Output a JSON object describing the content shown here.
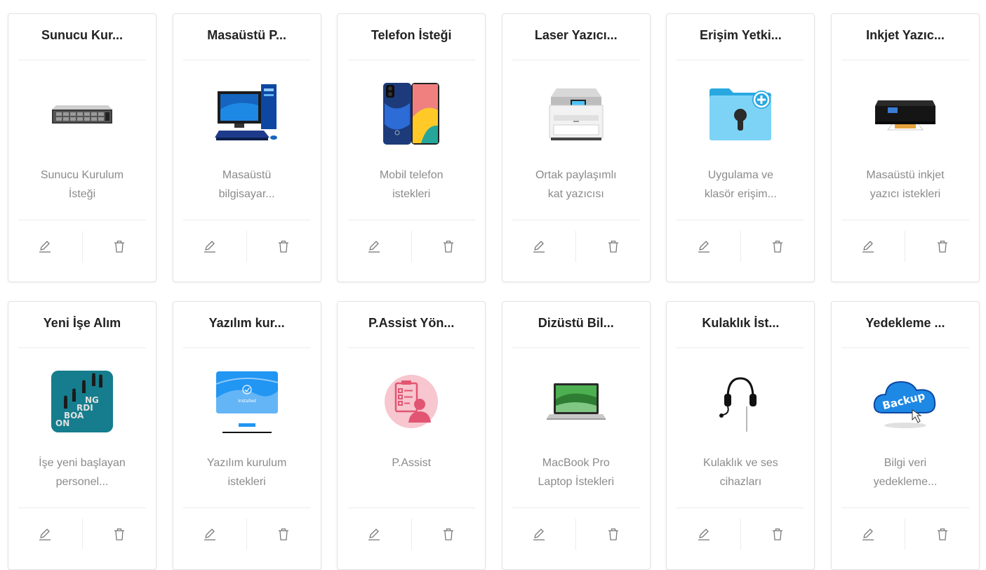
{
  "cards": [
    {
      "title": "Sunucu Kur...",
      "description": "Sunucu Kurulum İsteği",
      "image": "server-rack-image"
    },
    {
      "title": "Masaüstü P...",
      "description": "Masaüstü bilgisayar...",
      "image": "desktop-computer-image"
    },
    {
      "title": "Telefon İsteği",
      "description": "Mobil telefon istekleri",
      "image": "mobile-phone-image"
    },
    {
      "title": "Laser Yazıcı...",
      "description": "Ortak paylaşımlı kat yazıcısı",
      "image": "laser-printer-image"
    },
    {
      "title": "Erişim Yetki...",
      "description": "Uygulama ve klasör erişim...",
      "image": "folder-access-image"
    },
    {
      "title": "Inkjet Yazıc...",
      "description": "Masaüstü inkjet yazıcı istekleri",
      "image": "inkjet-printer-image"
    },
    {
      "title": "Yeni İşe Alım",
      "description": "İşe yeni başlayan personel...",
      "image": "onboarding-image",
      "image_text": [
        "NG",
        "RDI",
        "BOA",
        "ON"
      ]
    },
    {
      "title": "Yazılım kur...",
      "description": "Yazılım kurulum istekleri",
      "image": "software-install-image",
      "image_text": [
        "Installed"
      ]
    },
    {
      "title": "P.Assist Yön...",
      "description": "P.Assist",
      "image": "checklist-user-image"
    },
    {
      "title": "Dizüstü Bil...",
      "description": "MacBook Pro Laptop İstekleri",
      "image": "laptop-image"
    },
    {
      "title": "Kulaklık İst...",
      "description": "Kulaklık ve ses cihazları",
      "image": "headset-image"
    },
    {
      "title": "Yedekleme ...",
      "description": "Bilgi veri yedekleme...",
      "image": "backup-image",
      "image_text": [
        "Backup"
      ]
    }
  ],
  "actions": {
    "edit_icon": "pencil-icon",
    "delete_icon": "trash-icon"
  },
  "colors": {
    "icon_gray": "#7a7a7a",
    "border": "#e3e3e3",
    "title": "#222222",
    "description": "#8b8b8b"
  }
}
